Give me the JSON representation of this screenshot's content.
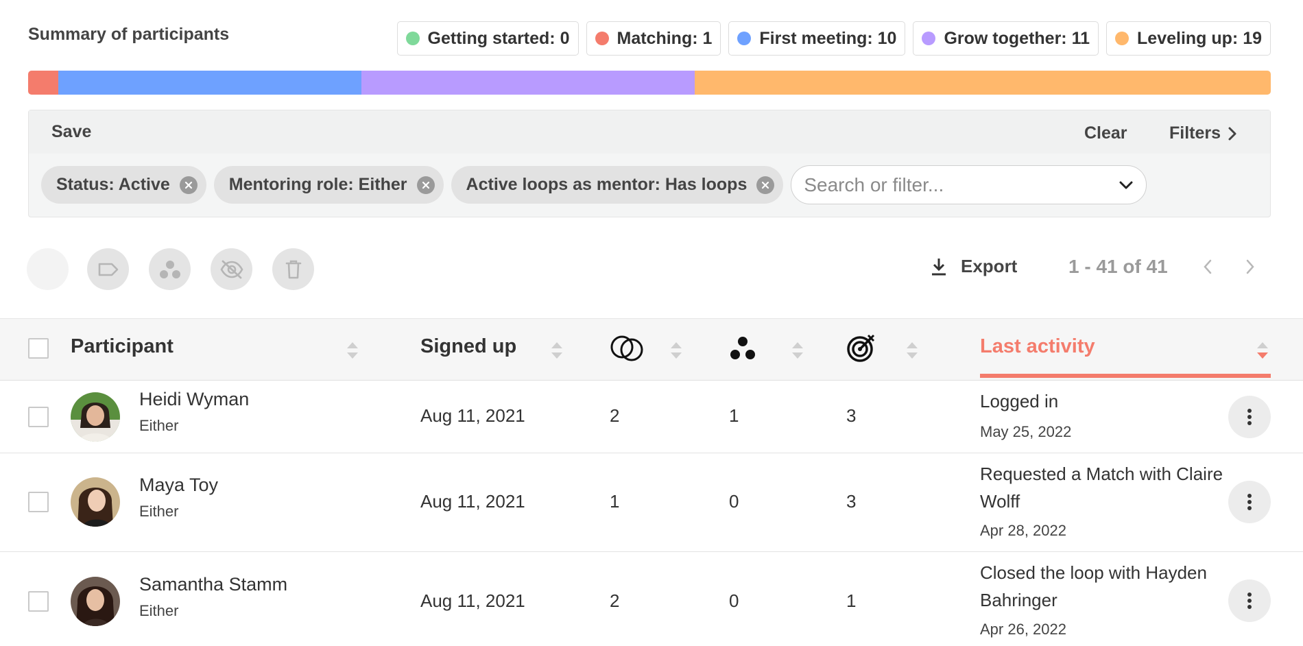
{
  "summary": {
    "title": "Summary of participants",
    "statuses": [
      {
        "label": "Getting started: 0",
        "count": 0,
        "color": "#7fd99a"
      },
      {
        "label": "Matching: 1",
        "count": 1,
        "color": "#f47c6c"
      },
      {
        "label": "First meeting: 10",
        "count": 10,
        "color": "#6ea1ff"
      },
      {
        "label": "Grow together: 11",
        "count": 11,
        "color": "#b89bff"
      },
      {
        "label": "Leveling up: 19",
        "count": 19,
        "color": "#ffb86c"
      }
    ]
  },
  "filters": {
    "save_label": "Save",
    "clear_label": "Clear",
    "filters_label": "Filters",
    "chips": [
      {
        "label": "Status: Active"
      },
      {
        "label": "Mentoring role: Either"
      },
      {
        "label": "Active loops as mentor: Has loops"
      }
    ],
    "search_placeholder": "Search or filter..."
  },
  "toolbar": {
    "icons": [
      "select-all-icon",
      "tag-icon",
      "group-icon",
      "hide-icon",
      "trash-icon"
    ],
    "export_label": "Export",
    "pagination": "1 - 41 of 41"
  },
  "table": {
    "columns": {
      "participant": "Participant",
      "signed_up": "Signed up",
      "col3_icon": "loops-icon",
      "col4_icon": "groups-icon",
      "col5_icon": "goals-icon",
      "last_activity": "Last activity"
    },
    "rows": [
      {
        "name": "Heidi Wyman",
        "role": "Either",
        "signed_up": "Aug 11, 2021",
        "loops": "2",
        "groups": "1",
        "goals": "3",
        "activity": "Logged in",
        "activity_date": "May 25, 2022"
      },
      {
        "name": "Maya Toy",
        "role": "Either",
        "signed_up": "Aug 11, 2021",
        "loops": "1",
        "groups": "0",
        "goals": "3",
        "activity": "Requested a Match with Claire Wolff",
        "activity_date": "Apr 28, 2022"
      },
      {
        "name": "Samantha Stamm",
        "role": "Either",
        "signed_up": "Aug 11, 2021",
        "loops": "2",
        "groups": "0",
        "goals": "1",
        "activity": "Closed the loop with Hayden Bahringer",
        "activity_date": "Apr 26, 2022"
      }
    ]
  }
}
